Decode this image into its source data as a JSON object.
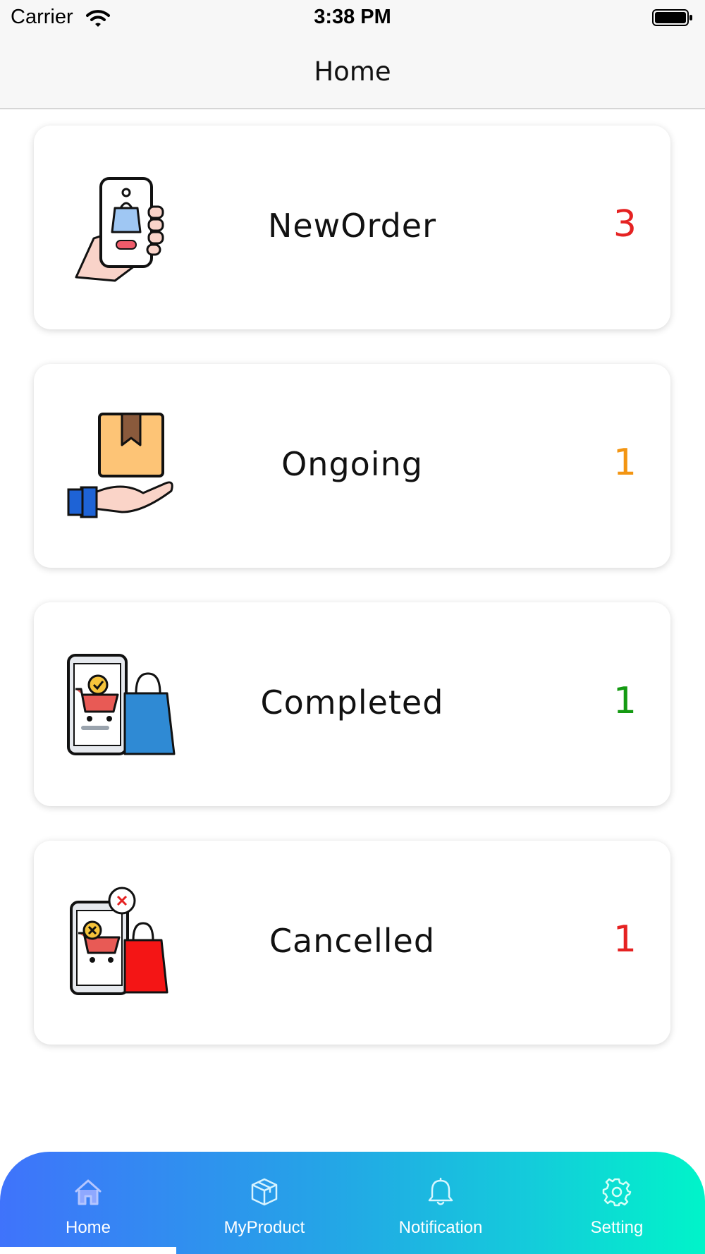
{
  "status_bar": {
    "carrier": "Carrier",
    "time": "3:38 PM"
  },
  "nav": {
    "title": "Home"
  },
  "cards": [
    {
      "label": "NewOrder",
      "count": "3",
      "color": "#e52222",
      "icon": "phone-shopping-bag-icon"
    },
    {
      "label": "Ongoing",
      "count": "1",
      "color": "#f39512",
      "icon": "hand-package-icon"
    },
    {
      "label": "Completed",
      "count": "1",
      "color": "#149a12",
      "icon": "cart-check-bag-icon"
    },
    {
      "label": "Cancelled",
      "count": "1",
      "color": "#e52222",
      "icon": "cart-cancel-bag-icon"
    }
  ],
  "tabs": [
    {
      "label": "Home",
      "icon": "home-icon",
      "active": true
    },
    {
      "label": "MyProduct",
      "icon": "box-icon",
      "active": false
    },
    {
      "label": "Notification",
      "icon": "bell-icon",
      "active": false
    },
    {
      "label": "Setting",
      "icon": "gear-icon",
      "active": false
    }
  ],
  "colors": {
    "gradient_start": "#3f73fb",
    "gradient_end": "#00f4c9"
  }
}
